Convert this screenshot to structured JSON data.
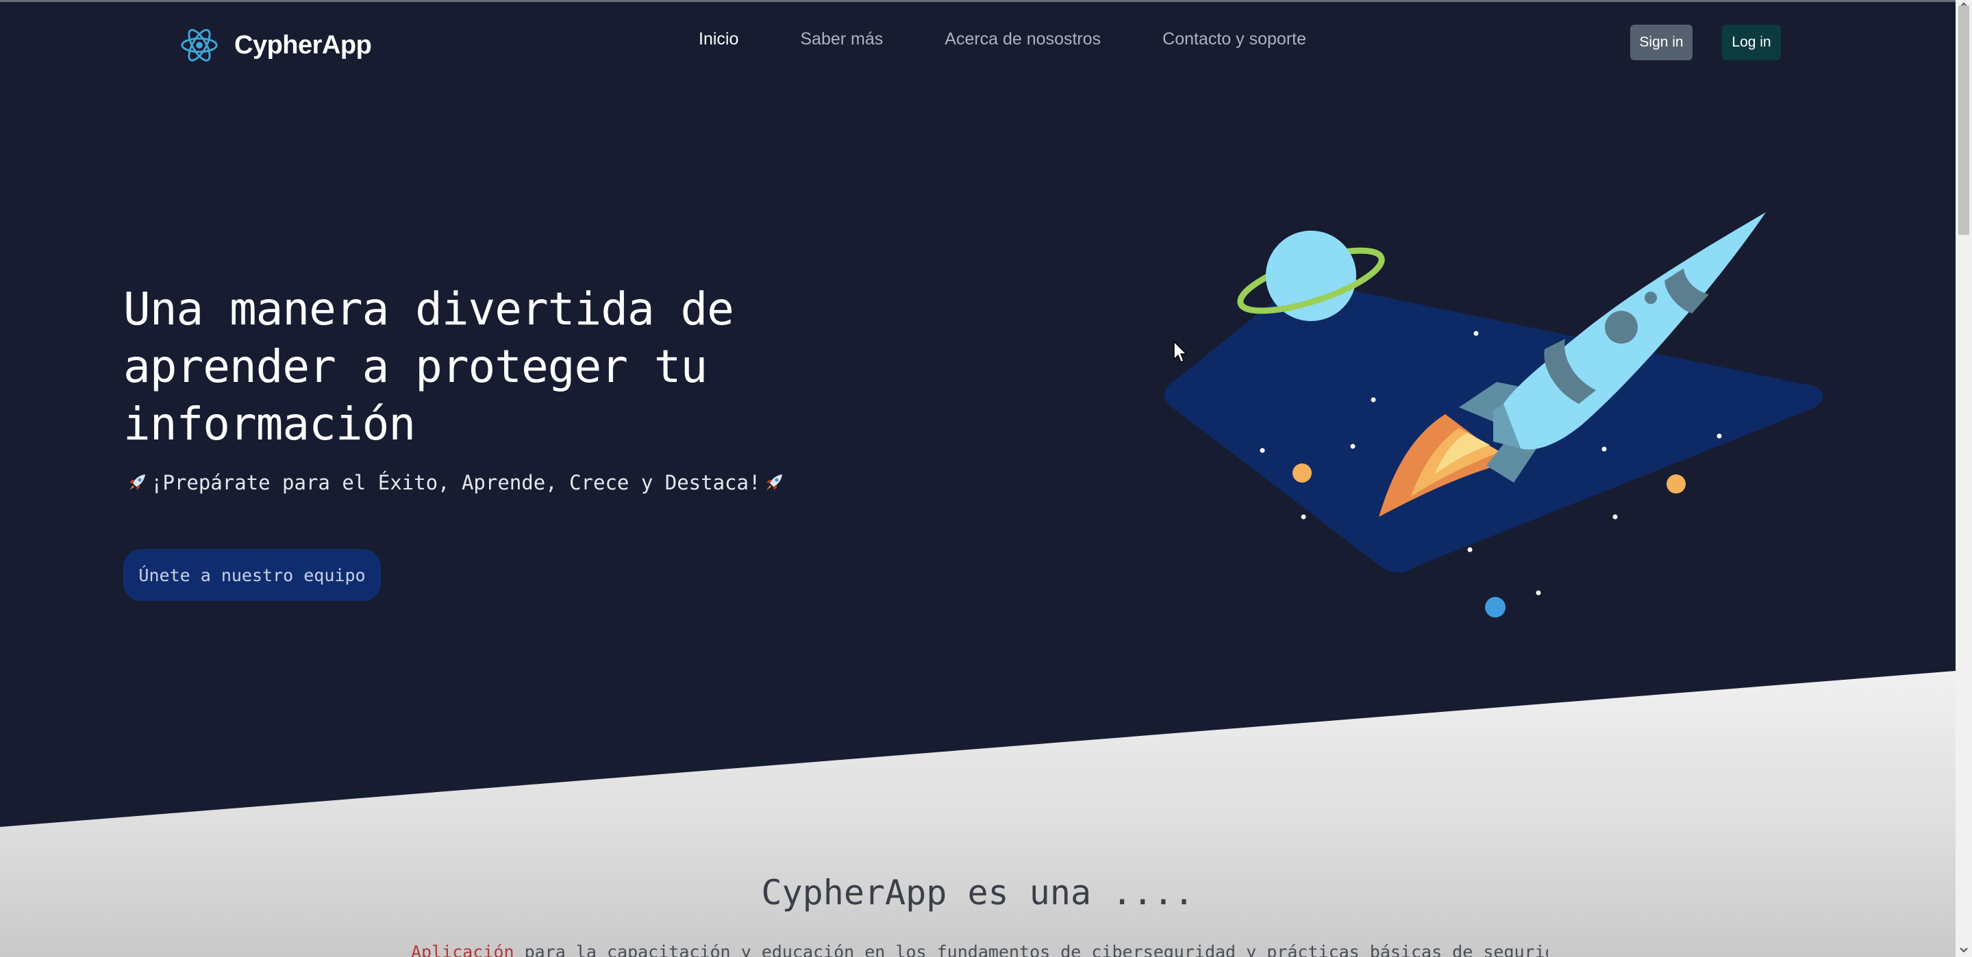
{
  "brand": {
    "name": "CypherApp",
    "icon": "atom-icon",
    "accent": "#3ea8d6"
  },
  "nav": {
    "items": [
      {
        "label": "Inicio",
        "active": true
      },
      {
        "label": "Saber más",
        "active": false
      },
      {
        "label": "Acerca de nosostros",
        "active": false
      },
      {
        "label": "Contacto y soporte",
        "active": false
      }
    ],
    "sign_in": "Sign in",
    "log_in": "Log in"
  },
  "hero": {
    "title": "Una manera divertida de aprender a proteger tu información",
    "subtitle": "¡Prepárate para el Éxito, Aprende, Crece y Destaca!",
    "subtitle_icon": "rocket-icon",
    "cta": "Únete a nuestro equipo",
    "illustration": "rocket-planet-illustration"
  },
  "about": {
    "title": "CypherApp es una ....",
    "text_accent": "Aplicación",
    "text_rest": " para la capacitación y educación en los fundamentos de ciberseguridad y prácticas básicas de seguridad informática"
  },
  "colors": {
    "background": "#171c31",
    "cta": "#0f2d6e",
    "sign_in": "#55606e",
    "log_in": "#0d3a3f",
    "lower_section": "#e4e4e4"
  }
}
